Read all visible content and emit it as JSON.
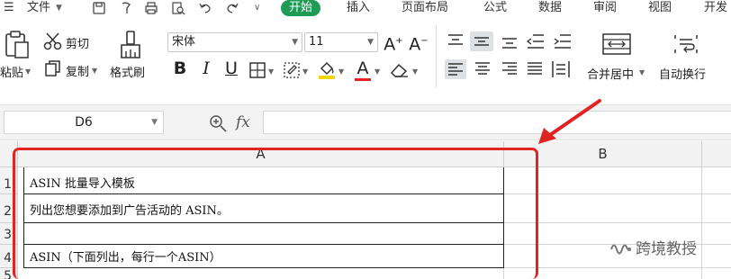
{
  "menubar": {
    "file_label": "文件",
    "tabs": [
      "开始",
      "插入",
      "页面布局",
      "公式",
      "数据",
      "审阅",
      "视图",
      "开发"
    ],
    "active_tab": "开始",
    "active_color": "#1e9b55"
  },
  "ribbon": {
    "paste_label": "粘贴",
    "cut_label": "剪切",
    "copy_label": "复制",
    "format_painter_label": "格式刷",
    "font_name": "宋体",
    "font_size": "11",
    "bold": "B",
    "italic": "I",
    "underline": "U",
    "font_color_letter": "A",
    "grow_font": "A",
    "shrink_font": "A",
    "merge_label": "合并居中",
    "wrap_label": "自动换行",
    "font_color_bar": "#e02424",
    "fill_color_bar": "#f2d50f"
  },
  "formula_bar": {
    "name_box": "D6",
    "fx": "fx",
    "formula": ""
  },
  "sheet": {
    "columns": [
      "A",
      "B"
    ],
    "rows": [
      "1",
      "2",
      "3",
      "4",
      "5"
    ],
    "cells": {
      "A1": "ASIN 批量导入模板",
      "A2": "列出您想要添加到广告活动的 ASIN。",
      "A3": "",
      "A4": "ASIN（下面列出，每行一个ASIN）"
    }
  },
  "annotation": {
    "highlight_color": "#e02424"
  },
  "watermark": {
    "text": "跨境教授",
    "icon": "wechat-channel-icon"
  }
}
